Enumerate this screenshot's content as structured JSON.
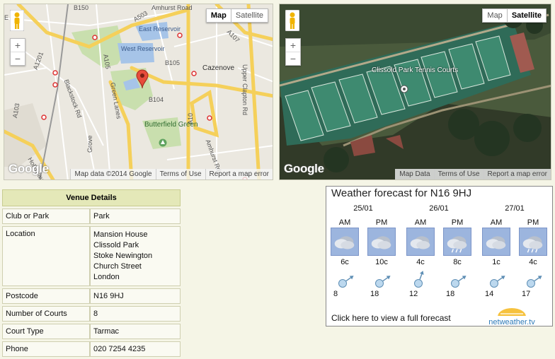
{
  "road_map": {
    "type_buttons": {
      "map": "Map",
      "satellite": "Satellite"
    },
    "zoom_in": "+",
    "zoom_out": "−",
    "logo": "Google",
    "attribution": [
      "Map data ©2014 Google",
      "Terms of Use",
      "Report a map error"
    ],
    "labels": {
      "b150": "B150",
      "amhurst_road_top": "Amhurst Road",
      "a503": "A503",
      "east_reservoir": "East Reservoir",
      "west_reservoir": "West Reservoir",
      "b105": "B105",
      "cazenove": "Cazenove",
      "upper_clapton_rd": "Upper Clapton Rd",
      "a107": "A107",
      "a1201": "A1201",
      "blackstock_rd": "Blackstock Rd",
      "green_lanes": "Green Lanes",
      "a105": "A105",
      "b104": "B104",
      "a10": "A10",
      "a103": "A103",
      "butterfield_green": "Butterfield Green",
      "amhurst_rd": "Amhurst Rd",
      "grove": "Grove",
      "holloway": "Holloway",
      "edge_e": "E"
    }
  },
  "sat_map": {
    "type_buttons": {
      "map": "Map",
      "satellite": "Satellite"
    },
    "zoom_in": "+",
    "zoom_out": "−",
    "logo": "Google",
    "place_label": "Clissold Park Tennis Courts",
    "attribution": [
      "Map Data",
      "Terms of Use",
      "Report a map error"
    ]
  },
  "venue": {
    "header": "Venue Details",
    "rows": [
      {
        "key": "Club or Park",
        "value": "Park"
      },
      {
        "key": "Location",
        "value_lines": [
          "Mansion House",
          "Clissold Park",
          "Stoke Newington",
          "Church Street",
          "London"
        ]
      },
      {
        "key": "Postcode",
        "value": "N16 9HJ"
      },
      {
        "key": "Number of Courts",
        "value": "8"
      },
      {
        "key": "Court Type",
        "value": "Tarmac"
      },
      {
        "key": "Phone",
        "value": "020 7254 4235"
      }
    ]
  },
  "weather": {
    "title": "Weather forecast for N16 9HJ",
    "days": [
      "25/01",
      "26/01",
      "27/01"
    ],
    "periods": [
      {
        "label": "AM",
        "icon": "cloudy-icon",
        "temp": "6c",
        "wind": "8"
      },
      {
        "label": "PM",
        "icon": "cloudy-icon",
        "temp": "10c",
        "wind": "18"
      },
      {
        "label": "AM",
        "icon": "cloudy-icon",
        "temp": "4c",
        "wind": "12"
      },
      {
        "label": "PM",
        "icon": "rain-icon",
        "temp": "8c",
        "wind": "18"
      },
      {
        "label": "AM",
        "icon": "cloudy-icon",
        "temp": "1c",
        "wind": "14"
      },
      {
        "label": "PM",
        "icon": "rain-icon",
        "temp": "4c",
        "wind": "17"
      }
    ],
    "link_text": "Click here to view a full forecast",
    "logo_text": "netweather.tv"
  }
}
